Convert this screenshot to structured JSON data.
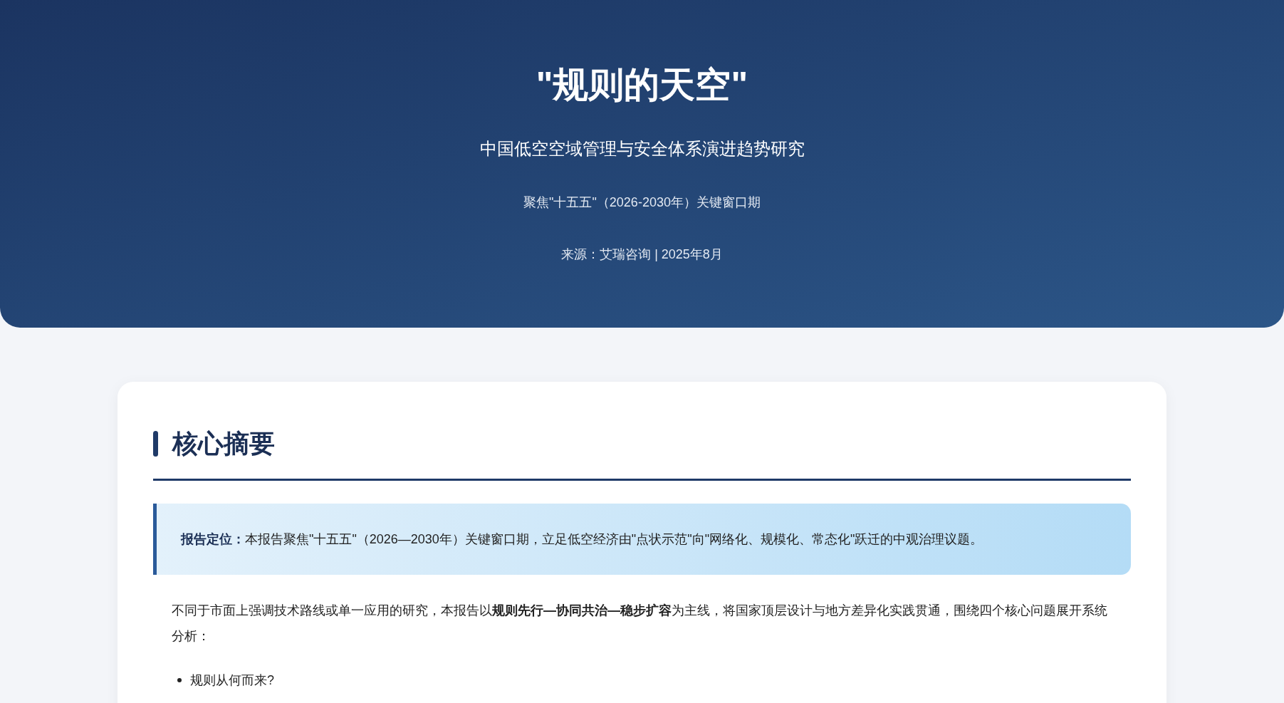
{
  "header": {
    "title": "\"规则的天空\"",
    "subtitle": "中国低空空域管理与安全体系演进趋势研究",
    "focus": "聚焦\"十五五\"（2026-2030年）关键窗口期",
    "source": "来源：艾瑞咨询 | 2025年8月"
  },
  "summary": {
    "heading": "核心摘要",
    "callout": "**报告定位：**本报告聚焦\"十五五\"（2026—2030年）关键窗口期，立足低空经济由\"点状示范\"向\"网络化、规模化、常态化\"跃迁的中观治理议题。",
    "paragraph": "不同于市面上强调技术路线或单一应用的研究，本报告以**规则先行—协同共治—稳步扩容**为主线，将国家顶层设计与地方差异化实践贯通，围绕四个核心问题展开系统分析：",
    "bullets": [
      "规则从何而来?"
    ]
  }
}
